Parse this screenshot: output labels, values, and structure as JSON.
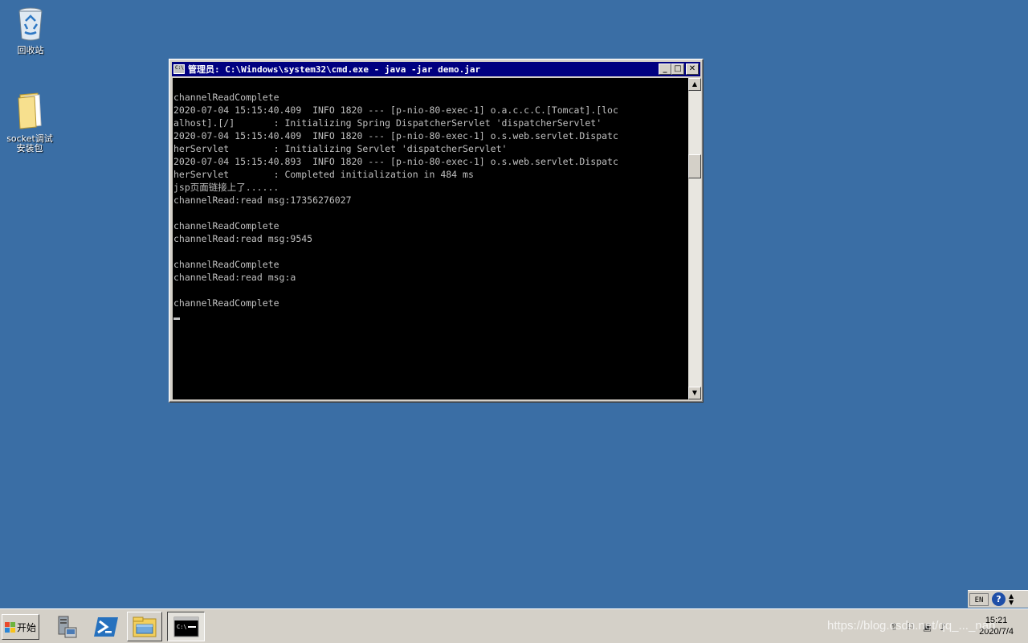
{
  "desktop": {
    "icons": [
      {
        "label": "回收站",
        "icon": "recycle-bin-icon"
      },
      {
        "label_line1": "socket调试",
        "label_line2": "安装包",
        "icon": "folder-icon"
      }
    ]
  },
  "window": {
    "title": "管理员: C:\\Windows\\system32\\cmd.exe - java  -jar demo.jar",
    "minimize_glyph": "_",
    "maximize_glyph": "□",
    "close_glyph": "✕",
    "console_lines": [
      "",
      "channelReadComplete",
      "2020-07-04 15:15:40.409  INFO 1820 --- [p-nio-80-exec-1] o.a.c.c.C.[Tomcat].[loc",
      "alhost].[/]       : Initializing Spring DispatcherServlet 'dispatcherServlet'",
      "2020-07-04 15:15:40.409  INFO 1820 --- [p-nio-80-exec-1] o.s.web.servlet.Dispatc",
      "herServlet        : Initializing Servlet 'dispatcherServlet'",
      "2020-07-04 15:15:40.893  INFO 1820 --- [p-nio-80-exec-1] o.s.web.servlet.Dispatc",
      "herServlet        : Completed initialization in 484 ms",
      "jsp页面链接上了......",
      "channelRead:read msg:17356276027",
      "",
      "channelReadComplete",
      "channelRead:read msg:9545",
      "",
      "channelReadComplete",
      "channelRead:read msg:a",
      "",
      "channelReadComplete"
    ]
  },
  "taskbar": {
    "start_label": "开始",
    "apps": [
      {
        "name": "server-manager-icon"
      },
      {
        "name": "powershell-icon"
      },
      {
        "name": "file-explorer-icon"
      },
      {
        "name": "cmd-icon"
      }
    ],
    "lang": "EN",
    "help_glyph": "?",
    "clock_time": "15:21",
    "clock_date": "2020/7/4"
  },
  "watermark": "https://blog.csdn.net/qq_..._nan",
  "colors": {
    "desktop": "#3a6ea5",
    "titlebar": "#000080",
    "console_bg": "#000000",
    "console_fg": "#c0c0c0"
  }
}
